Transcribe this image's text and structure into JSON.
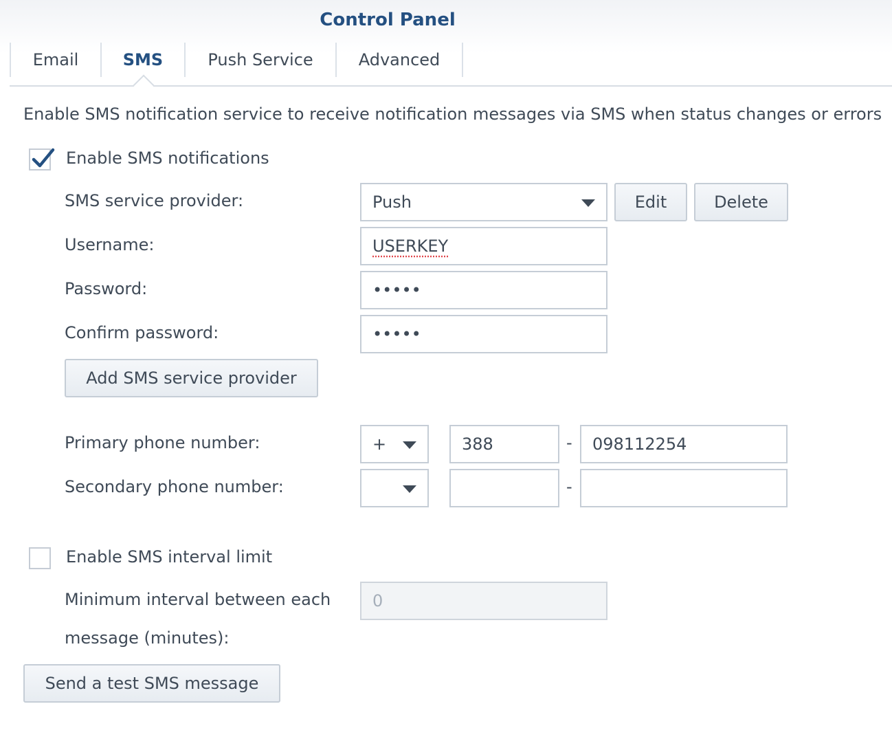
{
  "window": {
    "title": "Control Panel"
  },
  "tabs": [
    {
      "label": "Email",
      "active": false
    },
    {
      "label": "SMS",
      "active": true
    },
    {
      "label": "Push Service",
      "active": false
    },
    {
      "label": "Advanced",
      "active": false
    }
  ],
  "description": "Enable SMS notification service to receive notification messages via SMS when status changes or errors",
  "enable_sms": {
    "label": "Enable SMS notifications",
    "checked": true
  },
  "provider": {
    "label": "SMS service provider:",
    "value": "Push",
    "edit_label": "Edit",
    "delete_label": "Delete"
  },
  "username": {
    "label": "Username:",
    "value": "USERKEY"
  },
  "password": {
    "label": "Password:",
    "value": "•••••"
  },
  "confirm_password": {
    "label": "Confirm password:",
    "value": "•••••"
  },
  "add_provider_label": "Add SMS service provider",
  "primary_phone": {
    "label": "Primary phone number:",
    "country_code": "+",
    "area_code": "388",
    "separator": "-",
    "number": "098112254"
  },
  "secondary_phone": {
    "label": "Secondary phone number:",
    "country_code": "",
    "area_code": "",
    "separator": "-",
    "number": ""
  },
  "interval_limit": {
    "label": "Enable SMS interval limit",
    "checked": false,
    "min_label_line1": "Minimum interval between each",
    "min_label_line2": "message (minutes):",
    "value": "0"
  },
  "test_button_label": "Send a test SMS message",
  "colors": {
    "accent": "#245081",
    "text": "#3f4a57",
    "border": "#c5cdd6"
  },
  "icons": {
    "check": "checkmark-icon",
    "dropdown": "chevron-down-icon"
  }
}
